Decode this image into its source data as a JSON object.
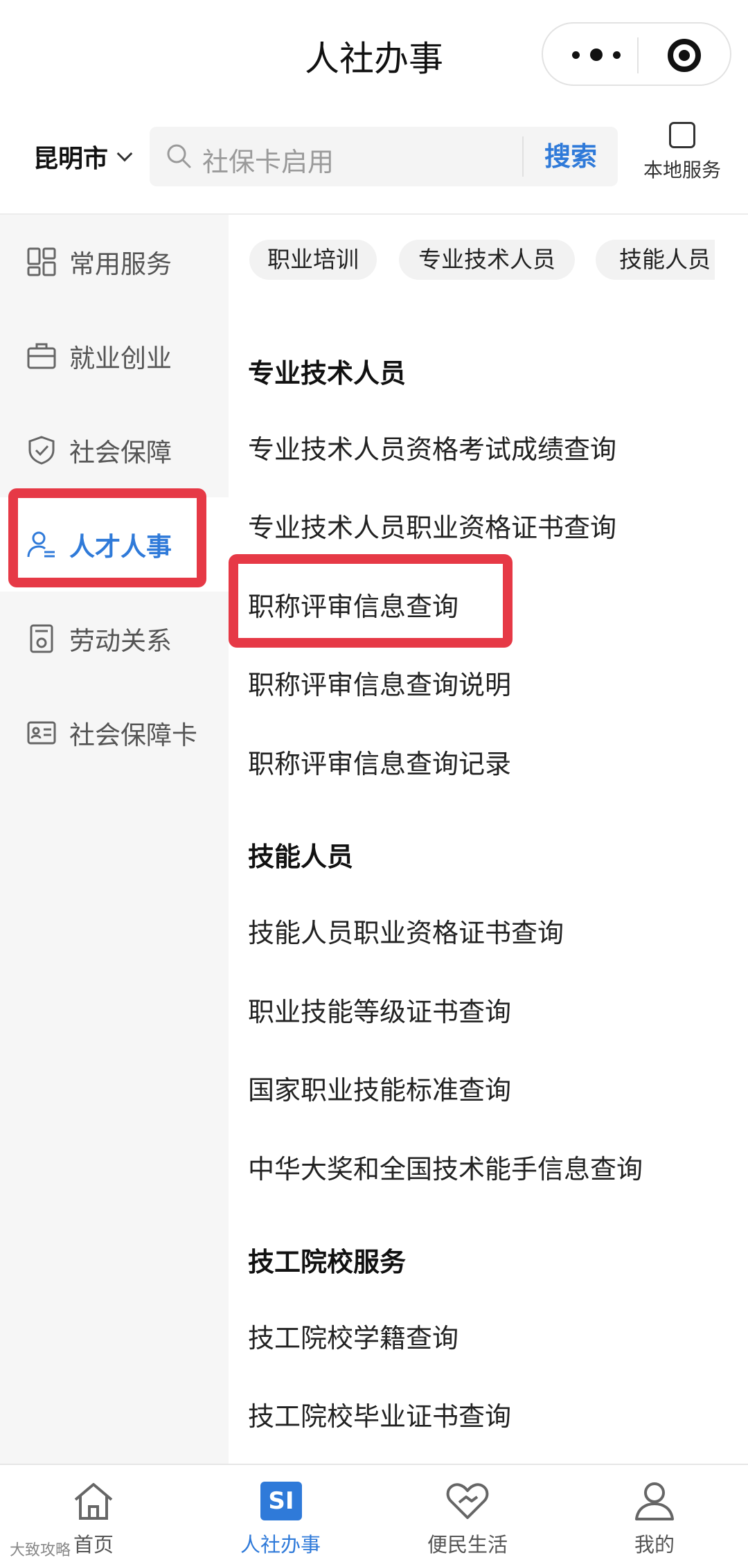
{
  "title_bar": {
    "title": "人社办事"
  },
  "location": {
    "city": "昆明市"
  },
  "search": {
    "placeholder": "社保卡启用",
    "button_label": "搜索"
  },
  "local_service": {
    "label": "本地服务"
  },
  "sidebar": {
    "items": [
      {
        "label": "常用服务",
        "icon": "grid-icon",
        "active": false
      },
      {
        "label": "就业创业",
        "icon": "briefcase-icon",
        "active": false
      },
      {
        "label": "社会保障",
        "icon": "shield-check-icon",
        "active": false
      },
      {
        "label": "人才人事",
        "icon": "person-list-icon",
        "active": true
      },
      {
        "label": "劳动关系",
        "icon": "document-badge-icon",
        "active": false
      },
      {
        "label": "社会保障卡",
        "icon": "id-card-icon",
        "active": false
      }
    ]
  },
  "chips": [
    "职业培训",
    "专业技术人员",
    "技能人员"
  ],
  "sections": [
    {
      "title": "专业技术人员",
      "items": [
        "专业技术人员资格考试成绩查询",
        "专业技术人员职业资格证书查询",
        "职称评审信息查询",
        "职称评审信息查询说明",
        "职称评审信息查询记录"
      ]
    },
    {
      "title": "技能人员",
      "items": [
        "技能人员职业资格证书查询",
        "职业技能等级证书查询",
        "国家职业技能标准查询",
        "中华大奖和全国技术能手信息查询"
      ]
    },
    {
      "title": "技工院校服务",
      "items": [
        "技工院校学籍查询",
        "技工院校毕业证书查询"
      ]
    }
  ],
  "tabbar": {
    "items": [
      {
        "label": "首页",
        "icon": "home-icon",
        "active": false
      },
      {
        "label": "人社办事",
        "icon": "si-badge-icon",
        "badge_text": "SI",
        "active": true
      },
      {
        "label": "便民生活",
        "icon": "heart-handshake-icon",
        "active": false
      },
      {
        "label": "我的",
        "icon": "user-icon",
        "active": false
      }
    ]
  },
  "watermark": {
    "text": "大致攻略"
  },
  "colors": {
    "accent": "#2f7ad9",
    "highlight_box": "#e63946",
    "sidebar_bg": "#f6f6f6"
  }
}
